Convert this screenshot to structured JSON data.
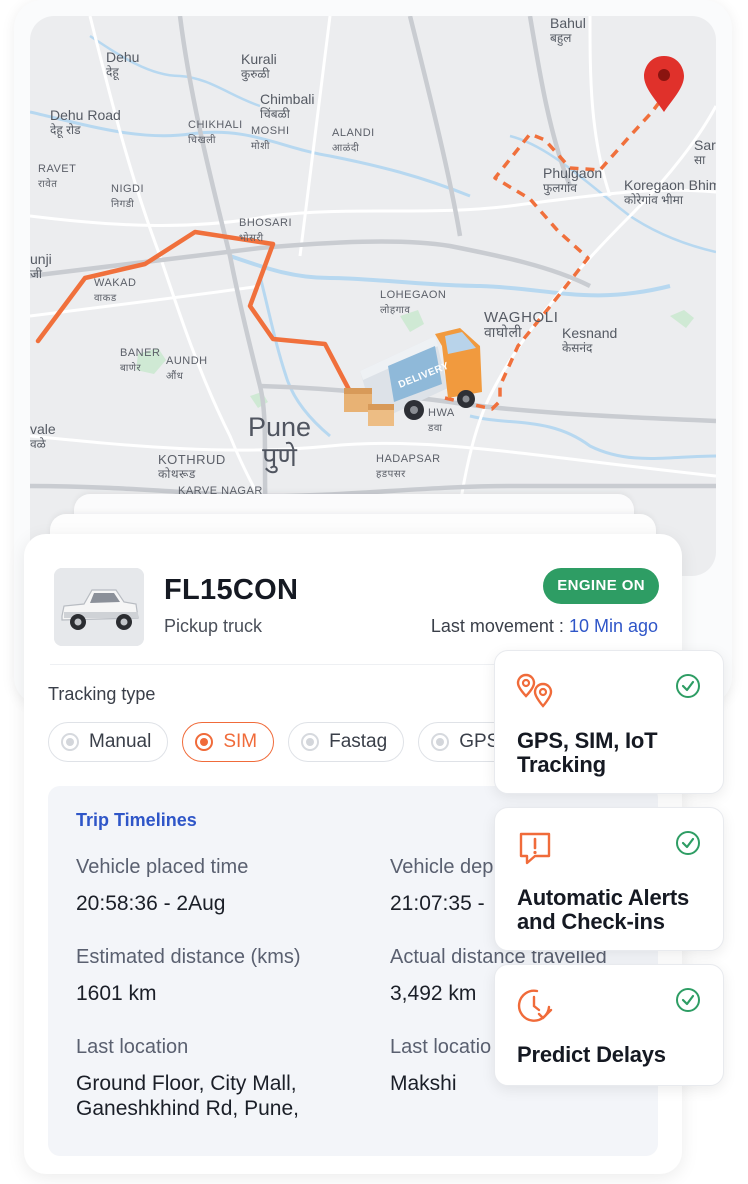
{
  "map": {
    "places": [
      {
        "id": "dehu",
        "name": "Dehu",
        "local": "देहू"
      },
      {
        "id": "kurali",
        "name": "Kurali",
        "local": "कुरुळी"
      },
      {
        "id": "chimbali",
        "name": "Chimbali",
        "local": "चिंबळी"
      },
      {
        "id": "bahul",
        "name": "Bahul",
        "local": "बहुल"
      },
      {
        "id": "dehu-road",
        "name": "Dehu Road",
        "local": "देहू रोड"
      },
      {
        "id": "chikhali",
        "name": "CHIKHALI",
        "local": "चिखली"
      },
      {
        "id": "moshi",
        "name": "MOSHI",
        "local": "मोशी"
      },
      {
        "id": "alandi",
        "name": "ALANDI",
        "local": "आळंदी"
      },
      {
        "id": "sar",
        "name": "Sar",
        "local": "सा"
      },
      {
        "id": "ravet",
        "name": "RAVET",
        "local": "रावेत"
      },
      {
        "id": "nigdi",
        "name": "NIGDI",
        "local": "निगडी"
      },
      {
        "id": "phulgaon",
        "name": "Phulgaon",
        "local": "फुलगांव"
      },
      {
        "id": "koregaon-bhima",
        "name": "Koregaon Bhima",
        "local": "कोरेगांव भीमा"
      },
      {
        "id": "bhosari",
        "name": "BHOSARI",
        "local": "भोसरी"
      },
      {
        "id": "unji",
        "name": "unji",
        "local": "जी"
      },
      {
        "id": "wakad",
        "name": "WAKAD",
        "local": "वाकड"
      },
      {
        "id": "lohegaon",
        "name": "LOHEGAON",
        "local": "लोहगाव"
      },
      {
        "id": "wagholi",
        "name": "WAGHOLI",
        "local": "वाघोली"
      },
      {
        "id": "kesnand",
        "name": "Kesnand",
        "local": "केसनंद"
      },
      {
        "id": "baner",
        "name": "BANER",
        "local": "बाणेर"
      },
      {
        "id": "aundh",
        "name": "AUNDH",
        "local": "औंध"
      },
      {
        "id": "pune",
        "name": "Pune",
        "local": "पुणे"
      },
      {
        "id": "hwa",
        "name": "HWA",
        "local": "डवा"
      },
      {
        "id": "vale",
        "name": "vale",
        "local": "वळे"
      },
      {
        "id": "kothrud",
        "name": "KOTHRUD",
        "local": "कोथरूड"
      },
      {
        "id": "hadapsar",
        "name": "HADAPSAR",
        "local": "हडपसर"
      },
      {
        "id": "karve-nagar",
        "name": "KARVE NAGAR",
        "local": ""
      }
    ],
    "truck_text": "DELIVERY",
    "route_color": "#f0703c",
    "pin_color": "#e0312b"
  },
  "vehicle": {
    "number": "FL15CON",
    "type": "Pickup truck",
    "engine_status": "ENGINE ON",
    "last_movement_label": "Last movement :",
    "last_movement_value": "10 Min ago"
  },
  "tracking": {
    "label": "Tracking type",
    "options": [
      "Manual",
      "SIM",
      "Fastag",
      "GPS"
    ],
    "selected": "SIM"
  },
  "timeline": {
    "title": "Trip Timelines",
    "fields": [
      {
        "label": "Vehicle placed time",
        "value": "20:58:36 - 2Aug"
      },
      {
        "label": "Vehicle dep",
        "value": "21:07:35 -"
      },
      {
        "label": "Estimated distance (kms)",
        "value": "1601 km"
      },
      {
        "label": "Actual distance travelled",
        "value": "3,492 km"
      },
      {
        "label": "Last location",
        "value": "Ground Floor, City Mall,\nGaneshkhind Rd, Pune,"
      },
      {
        "label": "Last locatio",
        "value": "Makshi"
      }
    ]
  },
  "features": [
    {
      "title": "GPS, SIM, IoT Tracking",
      "icon": "location-pins-icon"
    },
    {
      "title": "Automatic Alerts and Check-ins",
      "icon": "alert-message-icon"
    },
    {
      "title": "Predict Delays",
      "icon": "clock-check-icon"
    }
  ],
  "colors": {
    "accent": "#f06b3a",
    "engine_on": "#2e9d64",
    "link_blue": "#2f56c8",
    "check_green": "#2e9d64"
  }
}
